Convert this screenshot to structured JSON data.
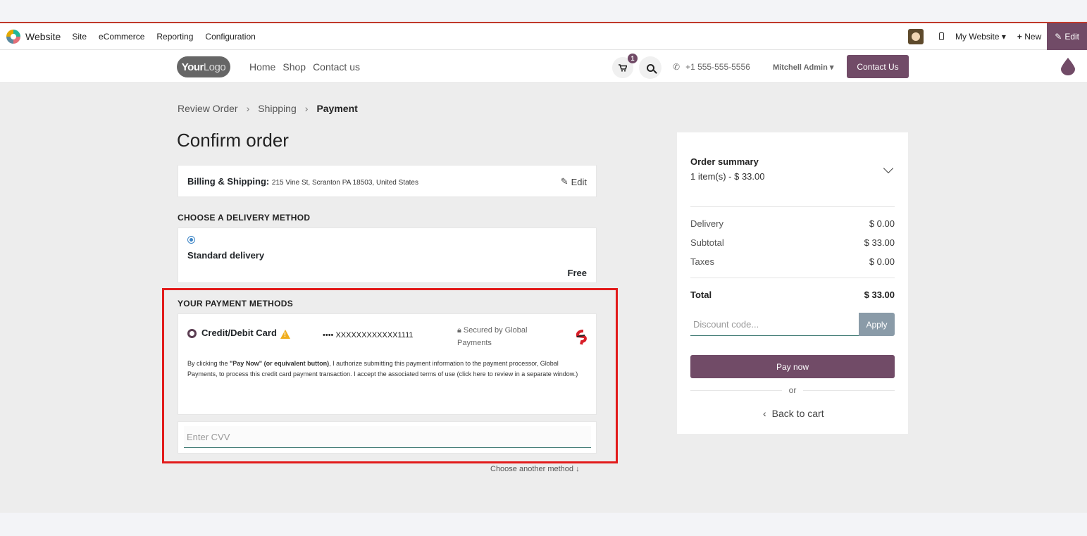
{
  "editbar": {
    "app_name": "Website",
    "menus": [
      "Site",
      "eCommerce",
      "Reporting",
      "Configuration"
    ],
    "my_website": "My Website ▾",
    "new_label": "New",
    "edit_label": "Edit"
  },
  "header": {
    "logo_bold": "Your",
    "logo_light": "Logo",
    "nav": [
      "Home",
      "Shop",
      "Contact us"
    ],
    "cart_count": "1",
    "phone": "+1 555-555-5556",
    "user": "Mitchell Admin",
    "contact_button": "Contact Us"
  },
  "breadcrumb": {
    "step1": "Review Order",
    "step2": "Shipping",
    "step3": "Payment",
    "separator": "›"
  },
  "page_title": "Confirm order",
  "billing": {
    "label": "Billing & Shipping:",
    "address": "215 Vine St, Scranton PA 18503, United States",
    "edit": "Edit"
  },
  "delivery": {
    "heading": "CHOOSE A DELIVERY METHOD",
    "method": "Standard delivery",
    "price": "Free"
  },
  "payment": {
    "heading": "YOUR PAYMENT METHODS",
    "method": "Credit/Debit Card",
    "card_number": "•••• XXXXXXXXXXXX1111",
    "secured": "Secured by Global Payments",
    "terms_pre": "By clicking the ",
    "terms_bold": "\"Pay Now\" (or equivalent button)",
    "terms_post": ", I authorize submitting this payment information to the payment processor, Global Payments, to process this credit card payment transaction. I accept the associated terms of use (click here to review in a separate window.)",
    "cvv_placeholder": "Enter CVV",
    "choose_another": "Choose another method ↓"
  },
  "summary": {
    "title": "Order summary",
    "items": "1 item(s) -  $ 33.00",
    "rows": [
      {
        "label": "Delivery",
        "value": "$ 0.00"
      },
      {
        "label": "Subtotal",
        "value": "$ 33.00"
      },
      {
        "label": "Taxes",
        "value": "$ 0.00"
      }
    ],
    "total_label": "Total",
    "total_value": "$ 33.00",
    "discount_placeholder": "Discount code...",
    "apply": "Apply",
    "pay_now": "Pay now",
    "or": "or",
    "back": "Back to cart"
  },
  "colors": {
    "brand": "#714b67",
    "highlight": "#e21b1b",
    "warning": "#f0ad1c"
  }
}
